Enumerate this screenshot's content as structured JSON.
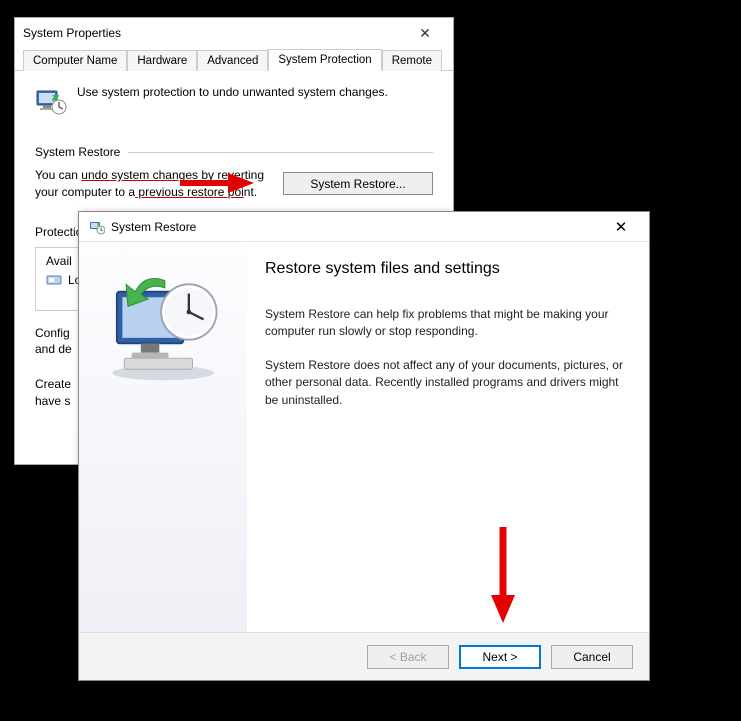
{
  "props": {
    "title": "System Properties",
    "tabs": {
      "computer_name": "Computer Name",
      "hardware": "Hardware",
      "advanced": "Advanced",
      "system_protection": "System Protection",
      "remote": "Remote"
    },
    "intro": "Use system protection to undo unwanted system changes.",
    "section_restore": "System Restore",
    "restore_desc_a": "You can ",
    "restore_desc_underlined": "undo system changes by re",
    "restore_desc_b_frag1": "verting",
    "restore_desc_line2a": "your computer to a",
    "restore_desc_line2_under": " previous restore poi",
    "restore_desc_line2b": "nt.",
    "restore_button": "System Restore...",
    "section_protection_prefix": "Protectio",
    "avail_header": "Avail",
    "drive_label": "Lo",
    "configure_line1": "Config",
    "configure_line2": "and de",
    "create_line1": "Create",
    "create_line2": "have s"
  },
  "wizard": {
    "title": "System Restore",
    "heading": "Restore system files and settings",
    "p1": "System Restore can help fix problems that might be making your computer run slowly or stop responding.",
    "p2": "System Restore does not affect any of your documents, pictures, or other personal data. Recently installed programs and drivers might be uninstalled.",
    "back": "< Back",
    "next": "Next >",
    "cancel": "Cancel"
  }
}
